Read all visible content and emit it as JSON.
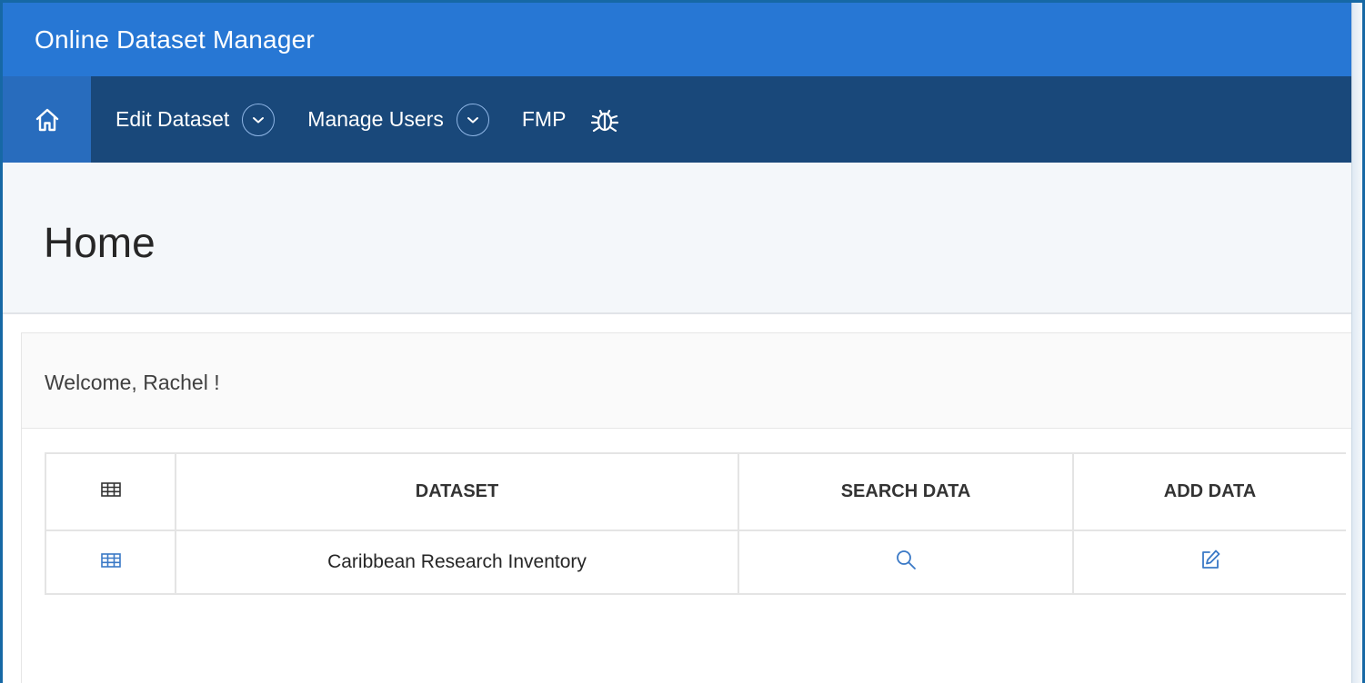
{
  "app": {
    "title": "Online Dataset Manager"
  },
  "nav": {
    "home_icon": "home-icon",
    "items": [
      {
        "label": "Edit Dataset",
        "has_dropdown": true
      },
      {
        "label": "Manage Users",
        "has_dropdown": true
      },
      {
        "label": "FMP",
        "has_dropdown": false
      }
    ],
    "bug_icon": "bug-icon"
  },
  "page": {
    "title": "Home"
  },
  "region": {
    "welcome": "Welcome, Rachel !"
  },
  "table": {
    "header_icon": "table-grid-icon",
    "columns": [
      "DATASET",
      "SEARCH DATA",
      "ADD DATA"
    ],
    "rows": [
      {
        "row_icon": "table-grid-icon",
        "dataset": "Caribbean Research Inventory",
        "search_icon": "search-icon",
        "add_icon": "edit-icon"
      }
    ]
  },
  "colors": {
    "titlebar": "#2777d4",
    "navbar": "#19487a",
    "nav_active": "#286cbd",
    "link_icon": "#3a79c6"
  }
}
